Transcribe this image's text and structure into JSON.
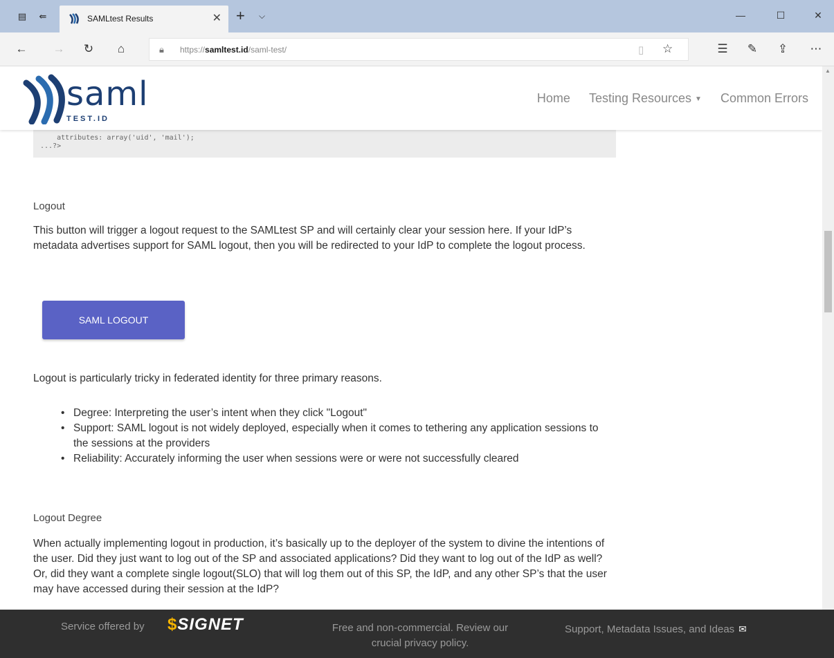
{
  "browser": {
    "tab_title": "SAMLtest Results",
    "url_prefix": "https://",
    "url_domain": "samltest.id",
    "url_path": "/saml-test/",
    "icons": [
      "tab-actions-icon",
      "tab-aside-icon",
      "favicon-icon",
      "close-icon",
      "new-tab-icon",
      "tab-list-icon",
      "minimize-icon",
      "maximize-icon",
      "window-close-icon",
      "back-icon",
      "forward-icon",
      "refresh-icon",
      "home-icon",
      "lock-icon",
      "reading-view-icon",
      "favorite-star-icon",
      "favorites-hub-icon",
      "pen-icon",
      "share-icon",
      "more-icon"
    ]
  },
  "site": {
    "logo_word": "saml",
    "logo_sub": "TEST.ID",
    "nav": {
      "home": "Home",
      "testing_resources": "Testing Resources",
      "common_errors": "Common Errors"
    }
  },
  "code": {
    "line1": "    attributes: array('uid', 'mail');",
    "line2": "...?>"
  },
  "logout": {
    "heading": "Logout",
    "paragraph": "This button will trigger a logout request to the SAMLtest SP and will certainly clear your session here. If your IdP’s metadata advertises support for SAML logout, then you will be redirected to your IdP to complete the logout process.",
    "button_label": "SAML LOGOUT",
    "tricky": "Logout is particularly tricky in federated identity for three primary reasons.",
    "reasons": [
      "Degree: Interpreting the user’s intent when they click \"Logout\"",
      "Support: SAML logout is not widely deployed, especially when it comes to tethering any application sessions to the sessions at the providers",
      "Reliability: Accurately informing the user when sessions were or were not successfully cleared"
    ],
    "degree_heading": "Logout Degree",
    "degree_paragraph": "When actually implementing logout in production, it’s basically up to the deployer of the system to divine the intentions of the user. Did they just want to log out of the SP and associated applications? Did they want to log out of the IdP as well? Or, did they want a complete single logout(SLO) that will log them out of this SP, the IdP, and any other SP’s that the user may have accessed during their session at the IdP?"
  },
  "footer": {
    "service": "Service offered by",
    "signet": "SIGNET",
    "free_line1": "Free and non-commercial. Review our",
    "free_line2": "crucial privacy policy.",
    "support": "Support, Metadata Issues, and Ideas"
  },
  "colors": {
    "titlebar": "#b5c6de",
    "button": "#5a62c5",
    "logo": "#1d3f73",
    "footer": "#2f2f2f",
    "signet_mark": "#f5b400"
  }
}
